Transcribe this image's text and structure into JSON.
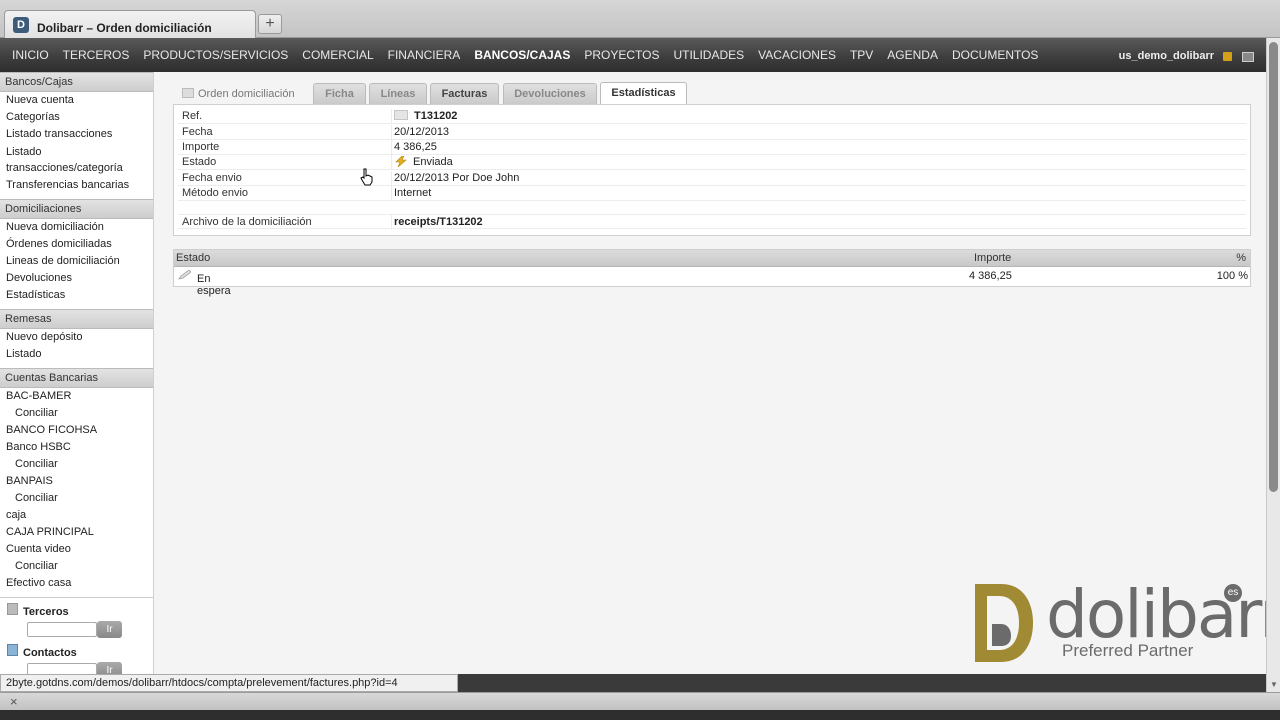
{
  "browser": {
    "tab_title": "Dolibarr – Orden domiciliación",
    "new_tab": "+",
    "favicon": "D"
  },
  "topmenu": {
    "items": [
      "INICIO",
      "TERCEROS",
      "PRODUCTOS/SERVICIOS",
      "COMERCIAL",
      "FINANCIERA",
      "BANCOS/CAJAS",
      "PROYECTOS",
      "UTILIDADES",
      "VACACIONES",
      "TPV",
      "AGENDA",
      "DOCUMENTOS"
    ],
    "active": "BANCOS/CAJAS",
    "user": "us_demo_dolibarr"
  },
  "sidebar": {
    "bancos_head": "Bancos/Cajas",
    "bancos_items": [
      "Nueva cuenta",
      "Categorías",
      "Listado transacciones",
      "Listado transacciones/categoría",
      "Transferencias bancarias"
    ],
    "domic_head": "Domiciliaciones",
    "domic_items": [
      "Nueva domiciliación",
      "Órdenes domiciliadas",
      "Lineas de domiciliación",
      "Devoluciones",
      "Estadísticas"
    ],
    "remesas_head": "Remesas",
    "remesas_items": [
      "Nuevo depósito",
      "Listado"
    ],
    "cuentas_head": "Cuentas Bancarias",
    "cuentas_items": [
      {
        "label": "BAC-BAMER",
        "sub": false
      },
      {
        "label": "Conciliar",
        "sub": true
      },
      {
        "label": "BANCO FICOHSA",
        "sub": false
      },
      {
        "label": "Banco HSBC",
        "sub": false
      },
      {
        "label": "Conciliar",
        "sub": true
      },
      {
        "label": "BANPAIS",
        "sub": false
      },
      {
        "label": "Conciliar",
        "sub": true
      },
      {
        "label": "caja",
        "sub": false
      },
      {
        "label": "CAJA PRINCIPAL",
        "sub": false
      },
      {
        "label": "Cuenta video",
        "sub": false
      },
      {
        "label": "Conciliar",
        "sub": true
      },
      {
        "label": "Efectivo casa",
        "sub": false
      }
    ],
    "search_terceros": "Terceros",
    "search_contactos": "Contactos",
    "go_button": "Ir"
  },
  "tabs": {
    "title": "Orden domiciliación",
    "items": [
      "Ficha",
      "Líneas",
      "Facturas",
      "Devoluciones",
      "Estadísticas"
    ],
    "active": "Estadísticas"
  },
  "details": {
    "ref_label": "Ref.",
    "ref_value": "T131202",
    "fecha_label": "Fecha",
    "fecha_value": "20/12/2013",
    "importe_label": "Importe",
    "importe_value": "4 386,25",
    "estado_label": "Estado",
    "estado_value": "Enviada",
    "fecha_envio_label": "Fecha envio",
    "fecha_envio_value": "20/12/2013 Por Doe John",
    "metodo_label": "Método envio",
    "metodo_value": "Internet",
    "archivo_label": "Archivo de la domiciliación",
    "archivo_value": "receipts/T131202"
  },
  "stats": {
    "col_estado": "Estado",
    "col_importe": "Importe",
    "col_pct": "%",
    "row_estado": "En espera",
    "row_importe": "4 386,25",
    "row_pct": "100 %"
  },
  "logo": {
    "word": "dolibarr",
    "badge": "es",
    "subtitle": "Preferred Partner"
  },
  "status_url": "2byte.gotdns.com/demos/dolibarr/htdocs/compta/prelevement/factures.php?id=4",
  "statusbar_close": "×",
  "colors": {
    "gold": "#a08a33",
    "logo_gray": "#6b6b6b"
  }
}
